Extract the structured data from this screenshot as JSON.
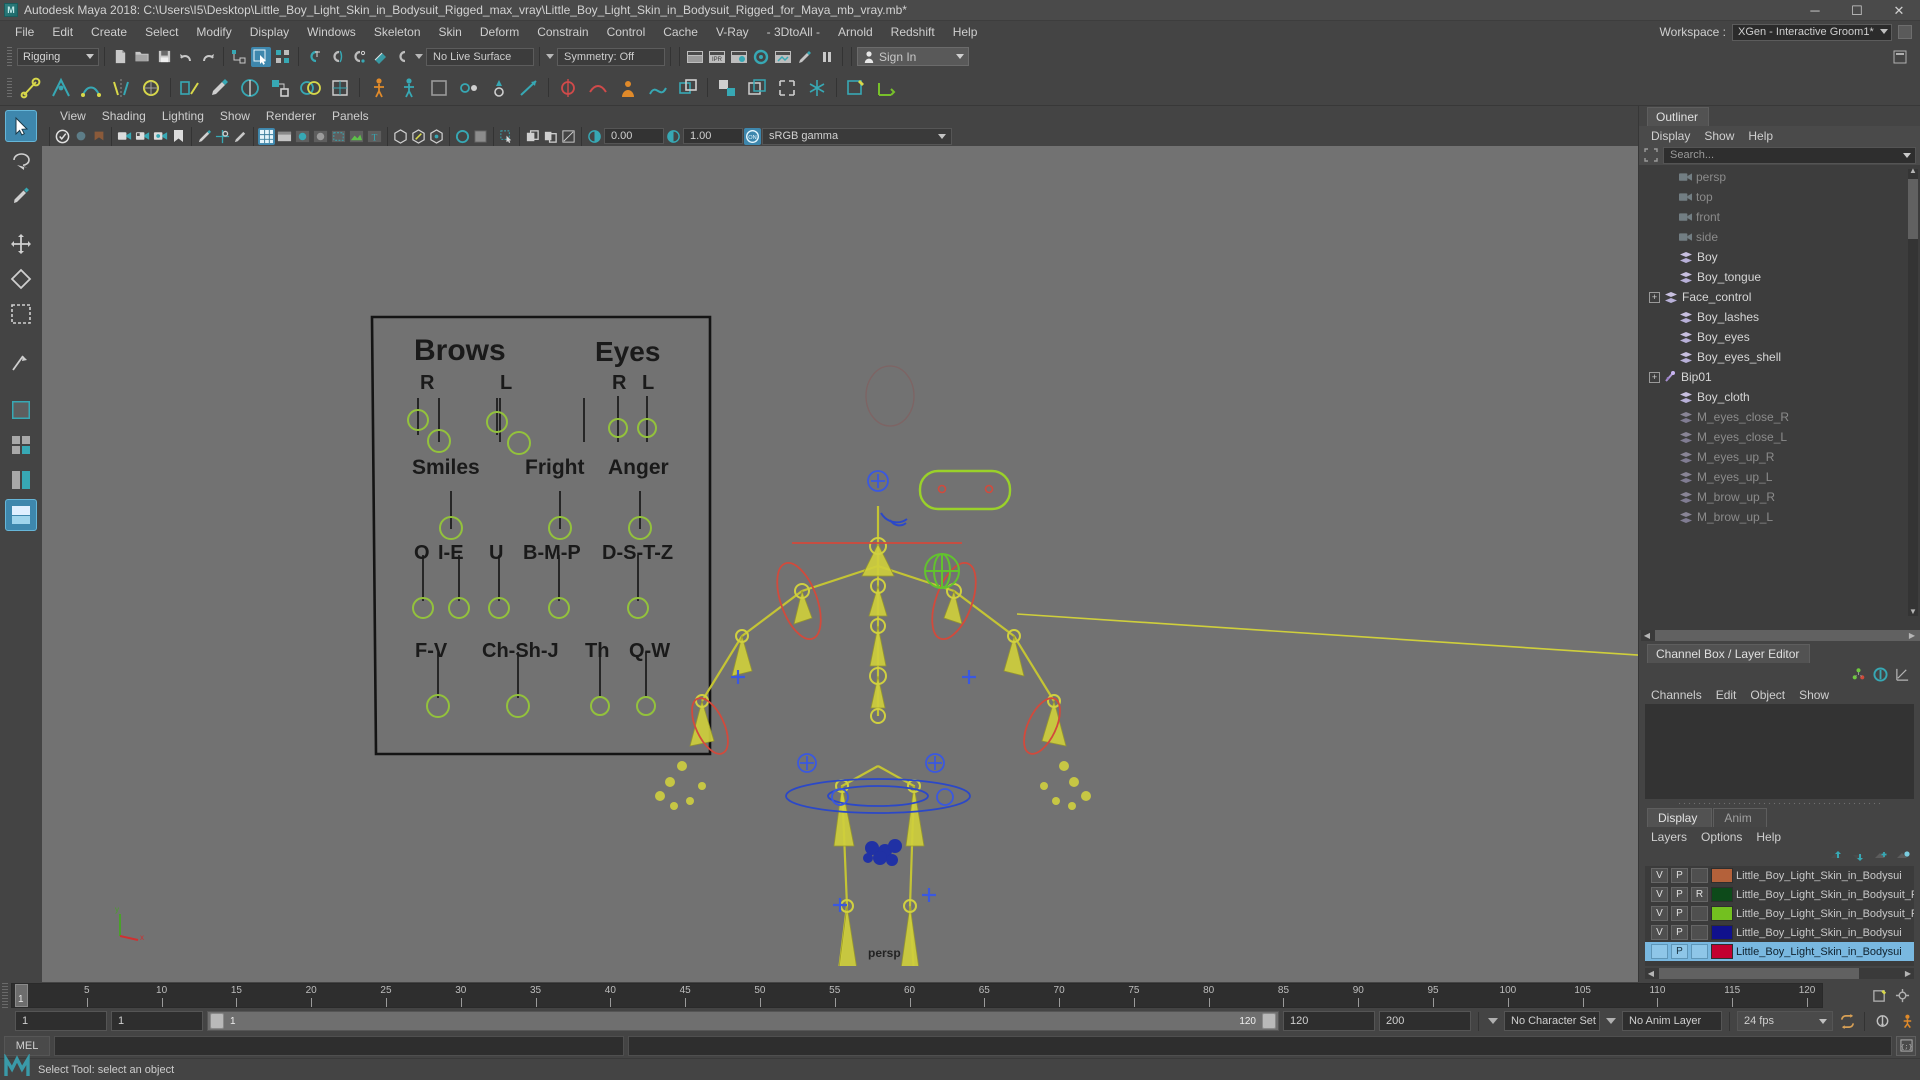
{
  "titlebar": {
    "title": "Autodesk Maya 2018: C:\\Users\\I5\\Desktop\\Little_Boy_Light_Skin_in_Bodysuit_Rigged_max_vray\\Little_Boy_Light_Skin_in_Bodysuit_Rigged_for_Maya_mb_vray.mb*",
    "logo": "M",
    "minimize": "─",
    "maximize": "☐",
    "close": "✕"
  },
  "menubar": {
    "items": [
      "File",
      "Edit",
      "Create",
      "Select",
      "Modify",
      "Display",
      "Windows",
      "Skeleton",
      "Skin",
      "Deform",
      "Constrain",
      "Control",
      "Cache",
      "V-Ray",
      "- 3DtoAll -",
      "Arnold",
      "Redshift",
      "Help"
    ],
    "workspace_label": "Workspace :",
    "workspace_value": "XGen - Interactive Groom1*"
  },
  "toolbar": {
    "mode": "Rigging",
    "live_surface": "No Live Surface",
    "symmetry": "Symmetry: Off",
    "signin": "Sign In"
  },
  "viewport_menu": {
    "items": [
      "View",
      "Shading",
      "Lighting",
      "Show",
      "Renderer",
      "Panels"
    ]
  },
  "viewport_toolbar": {
    "exposure": "0.00",
    "gamma_value": "1.00",
    "colorspace": "sRGB gamma",
    "on_badge": "ON"
  },
  "viewport": {
    "camera_label": "persp",
    "face_panel": {
      "groups": [
        {
          "label": "Brows",
          "sub": [
            "R",
            "L"
          ]
        },
        {
          "label": "Eyes",
          "sub": [
            "R",
            "L"
          ]
        }
      ],
      "row2": [
        "Smiles",
        "Fright",
        "Anger"
      ],
      "row3": [
        "O",
        "I-E",
        "U",
        "B-M-P",
        "D-S-T-Z"
      ],
      "row4": [
        "F-V",
        "Ch-Sh-J",
        "Th",
        "Q-W"
      ]
    }
  },
  "outliner": {
    "tab": "Outliner",
    "menus": [
      "Display",
      "Show",
      "Help"
    ],
    "search_placeholder": "Search...",
    "items": [
      {
        "label": "persp",
        "icon": "camera-icon",
        "indent": 1,
        "expand": false,
        "dim": true
      },
      {
        "label": "top",
        "icon": "camera-icon",
        "indent": 1,
        "expand": false,
        "dim": true
      },
      {
        "label": "front",
        "icon": "camera-icon",
        "indent": 1,
        "expand": false,
        "dim": true
      },
      {
        "label": "side",
        "icon": "camera-icon",
        "indent": 1,
        "expand": false,
        "dim": true
      },
      {
        "label": "Boy",
        "icon": "mesh-icon",
        "indent": 1,
        "expand": false,
        "dim": false
      },
      {
        "label": "Boy_tongue",
        "icon": "mesh-icon",
        "indent": 1,
        "expand": false,
        "dim": false
      },
      {
        "label": "Face_control",
        "icon": "mesh-icon",
        "indent": 0,
        "expand": true,
        "dim": false
      },
      {
        "label": "Boy_lashes",
        "icon": "mesh-icon",
        "indent": 1,
        "expand": false,
        "dim": false
      },
      {
        "label": "Boy_eyes",
        "icon": "mesh-icon",
        "indent": 1,
        "expand": false,
        "dim": false
      },
      {
        "label": "Boy_eyes_shell",
        "icon": "mesh-icon",
        "indent": 1,
        "expand": false,
        "dim": false
      },
      {
        "label": "Bip01",
        "icon": "joint-icon",
        "indent": 0,
        "expand": true,
        "dim": false
      },
      {
        "label": "Boy_cloth",
        "icon": "mesh-icon",
        "indent": 1,
        "expand": false,
        "dim": false
      },
      {
        "label": "M_eyes_close_R",
        "icon": "mesh-icon",
        "indent": 1,
        "expand": false,
        "dim": true
      },
      {
        "label": "M_eyes_close_L",
        "icon": "mesh-icon",
        "indent": 1,
        "expand": false,
        "dim": true
      },
      {
        "label": "M_eyes_up_R",
        "icon": "mesh-icon",
        "indent": 1,
        "expand": false,
        "dim": true
      },
      {
        "label": "M_eyes_up_L",
        "icon": "mesh-icon",
        "indent": 1,
        "expand": false,
        "dim": true
      },
      {
        "label": "M_brow_up_R",
        "icon": "mesh-icon",
        "indent": 1,
        "expand": false,
        "dim": true
      },
      {
        "label": "M_brow_up_L",
        "icon": "mesh-icon",
        "indent": 1,
        "expand": false,
        "dim": true
      }
    ]
  },
  "channelbox": {
    "tab": "Channel Box / Layer Editor",
    "menus": [
      "Channels",
      "Edit",
      "Object",
      "Show"
    ]
  },
  "layer_editor": {
    "tabs": [
      {
        "label": "Display",
        "active": true
      },
      {
        "label": "Anim",
        "active": false
      }
    ],
    "menus": [
      "Layers",
      "Options",
      "Help"
    ],
    "layers": [
      {
        "v": "V",
        "p": "P",
        "r": "",
        "color": "#b4613a",
        "name": "Little_Boy_Light_Skin_in_Bodysui",
        "selected": false
      },
      {
        "v": "V",
        "p": "P",
        "r": "R",
        "color": "#0d4a1a",
        "name": "Little_Boy_Light_Skin_in_Bodysuit_Rigg",
        "selected": false
      },
      {
        "v": "V",
        "p": "P",
        "r": "",
        "color": "#73c020",
        "name": "Little_Boy_Light_Skin_in_Bodysuit_Ri",
        "selected": false
      },
      {
        "v": "V",
        "p": "P",
        "r": "",
        "color": "#10118c",
        "name": "Little_Boy_Light_Skin_in_Bodysui",
        "selected": false
      },
      {
        "v": "",
        "p": "P",
        "r": "",
        "color": "#c2002f",
        "name": "Little_Boy_Light_Skin_in_Bodysui",
        "selected": true
      }
    ]
  },
  "timeline": {
    "ticks": [
      5,
      10,
      15,
      20,
      25,
      30,
      35,
      40,
      45,
      50,
      55,
      60,
      65,
      70,
      75,
      80,
      85,
      90,
      95,
      100,
      105,
      110,
      115,
      120
    ],
    "current_frame": "1",
    "range_start": "1",
    "range_end": "1",
    "range_bar_start": "1",
    "range_bar_end": "120",
    "anim_end": "120",
    "playback_end": "200",
    "character_set": "No Character Set",
    "anim_layer": "No Anim Layer",
    "fps": "24 fps"
  },
  "command_line": {
    "label": "MEL",
    "input": "",
    "output": ""
  },
  "statusbar": {
    "text": "Select Tool: select an object"
  },
  "colors": {
    "accent": "#3e87ad",
    "teal": "#37a8b4",
    "panel_bg": "#444444",
    "viewport_bg": "#727272",
    "select_blue": "#79b8e0",
    "joint_yellow": "#d8d83a",
    "curve_red": "#d04040",
    "curve_green": "#8ac020",
    "curve_blue": "#3050d0"
  }
}
